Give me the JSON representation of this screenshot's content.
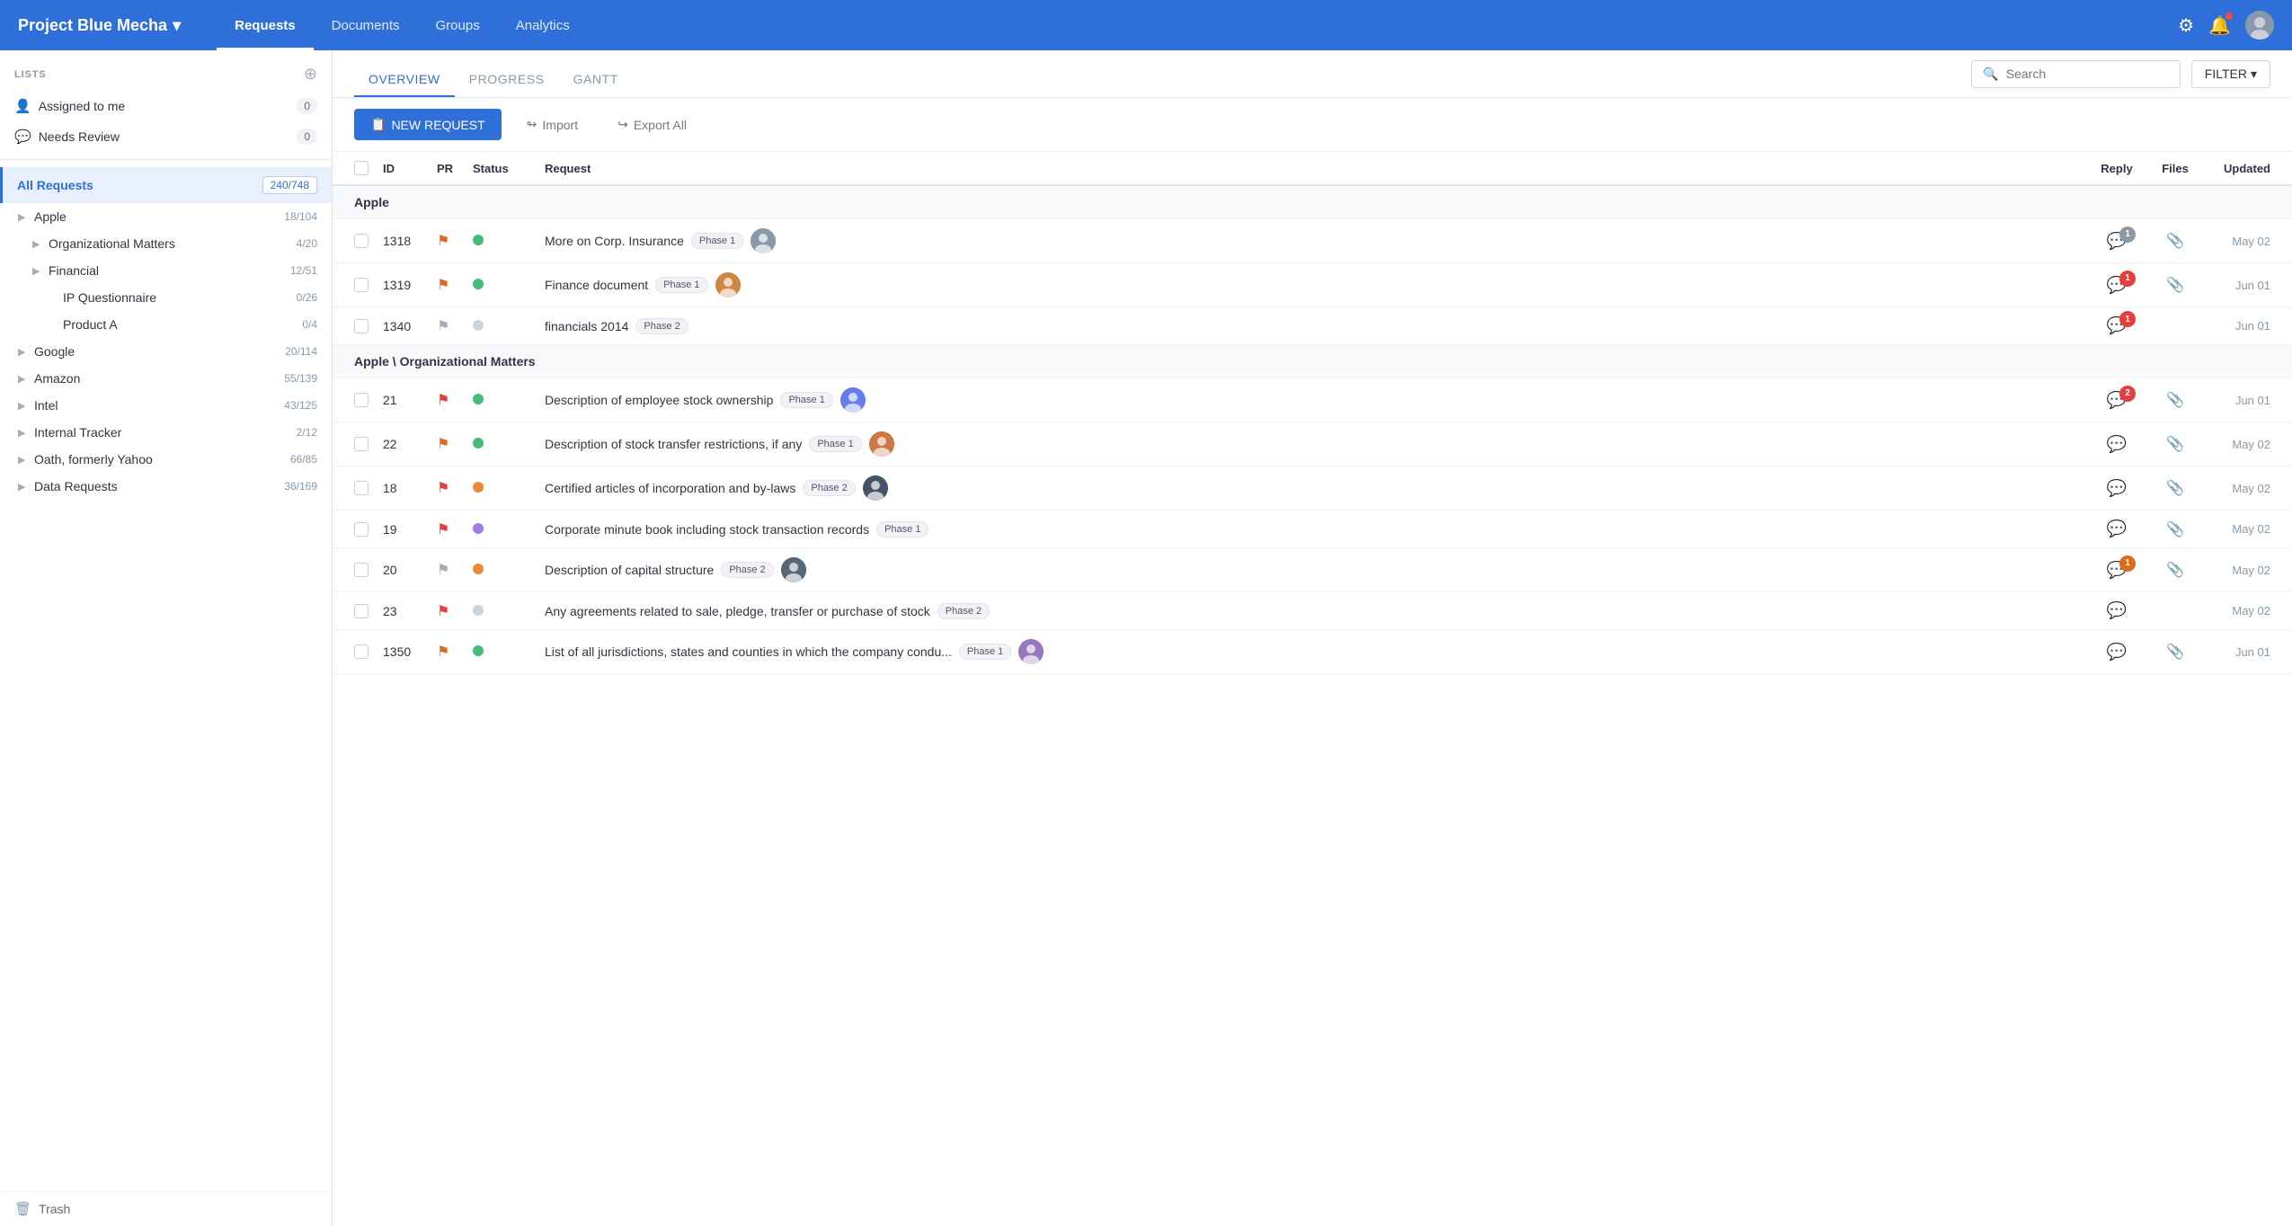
{
  "brand": {
    "title": "Project Blue Mecha",
    "chevron": "▾"
  },
  "top_nav": {
    "links": [
      {
        "label": "Requests",
        "active": true
      },
      {
        "label": "Documents",
        "active": false
      },
      {
        "label": "Groups",
        "active": false
      },
      {
        "label": "Analytics",
        "active": false
      }
    ]
  },
  "sidebar": {
    "lists_label": "LISTS",
    "items": [
      {
        "icon": "👤",
        "label": "Assigned to me",
        "count": "0"
      },
      {
        "icon": "💬",
        "label": "Needs Review",
        "count": "0"
      }
    ],
    "all_requests": {
      "label": "All Requests",
      "count": "240/748"
    },
    "tree": [
      {
        "level": 1,
        "label": "Apple",
        "count": "18/104",
        "expanded": true
      },
      {
        "level": 2,
        "label": "Organizational Matters",
        "count": "4/20",
        "expanded": false
      },
      {
        "level": 2,
        "label": "Financial",
        "count": "12/51",
        "expanded": false
      },
      {
        "level": 3,
        "label": "IP Questionnaire",
        "count": "0/26"
      },
      {
        "level": 3,
        "label": "Product A",
        "count": "0/4"
      },
      {
        "level": 1,
        "label": "Google",
        "count": "20/114",
        "expanded": false
      },
      {
        "level": 1,
        "label": "Amazon",
        "count": "55/139",
        "expanded": false
      },
      {
        "level": 1,
        "label": "Intel",
        "count": "43/125",
        "expanded": false
      },
      {
        "level": 1,
        "label": "Internal Tracker",
        "count": "2/12",
        "expanded": false
      },
      {
        "level": 1,
        "label": "Oath, formerly Yahoo",
        "count": "66/85",
        "expanded": false
      },
      {
        "level": 1,
        "label": "Data Requests",
        "count": "36/169",
        "expanded": false
      }
    ],
    "trash_label": "Trash"
  },
  "sub_nav": {
    "tabs": [
      {
        "label": "OVERVIEW",
        "active": true
      },
      {
        "label": "PROGRESS",
        "active": false
      },
      {
        "label": "GANTT",
        "active": false
      }
    ],
    "search_placeholder": "Search",
    "filter_label": "FILTER"
  },
  "toolbar": {
    "new_request_label": "NEW REQUEST",
    "import_label": "Import",
    "export_label": "Export All"
  },
  "table": {
    "headers": {
      "id": "ID",
      "pr": "PR",
      "status": "Status",
      "request": "Request",
      "reply": "Reply",
      "files": "Files",
      "updated": "Updated"
    },
    "groups": [
      {
        "name": "Apple",
        "rows": [
          {
            "id": "1318",
            "pr": "flag-orange",
            "status": "green",
            "request": "More on Corp. Insurance",
            "phase": "Phase 1",
            "has_avatar": true,
            "avatar_color": "#8899aa",
            "reply_count": "1",
            "reply_color": "gray",
            "has_clip": true,
            "updated": "May 02"
          },
          {
            "id": "1319",
            "pr": "flag-orange",
            "status": "green",
            "request": "Finance document",
            "phase": "Phase 1",
            "has_avatar": true,
            "avatar_color": "#cc8844",
            "reply_count": "1",
            "reply_color": "red",
            "has_clip": true,
            "updated": "Jun 01"
          },
          {
            "id": "1340",
            "pr": "flag-gray",
            "status": "gray",
            "request": "financials 2014",
            "phase": "Phase 2",
            "has_avatar": false,
            "reply_count": "1",
            "reply_color": "red",
            "has_clip": false,
            "updated": "Jun 01"
          }
        ]
      },
      {
        "name": "Apple \\Organizational Matters",
        "rows": [
          {
            "id": "21",
            "pr": "flag-red",
            "status": "green",
            "request": "Description of employee stock ownership",
            "phase": "Phase 1",
            "has_avatar": true,
            "avatar_color": "#667eea",
            "reply_count": "2",
            "reply_color": "red",
            "has_clip": true,
            "updated": "Jun 01"
          },
          {
            "id": "22",
            "pr": "flag-orange",
            "status": "green",
            "request": "Description of stock transfer restrictions, if any",
            "phase": "Phase 1",
            "has_avatar": true,
            "avatar_color": "#cc7744",
            "reply_count": "0",
            "reply_color": "none",
            "has_clip": true,
            "updated": "May 02"
          },
          {
            "id": "18",
            "pr": "flag-red",
            "status": "orange",
            "request": "Certified articles of incorporation and by-laws",
            "phase": "Phase 2",
            "has_avatar": true,
            "avatar_color": "#445566",
            "reply_count": "0",
            "reply_color": "none",
            "has_clip": true,
            "updated": "May 02"
          },
          {
            "id": "19",
            "pr": "flag-red",
            "status": "purple",
            "request": "Corporate minute book including stock transaction records",
            "phase": "Phase 1",
            "has_avatar": false,
            "reply_count": "0",
            "reply_color": "none",
            "has_clip": true,
            "updated": "May 02"
          },
          {
            "id": "20",
            "pr": "flag-gray",
            "status": "orange",
            "request": "Description of capital structure",
            "phase": "Phase 2",
            "has_avatar": true,
            "avatar_color": "#556677",
            "reply_count": "1",
            "reply_color": "orange",
            "has_clip": true,
            "updated": "May 02"
          },
          {
            "id": "23",
            "pr": "flag-red",
            "status": "gray",
            "request": "Any agreements related to sale, pledge, transfer or purchase of stock",
            "phase": "Phase 2",
            "has_avatar": false,
            "reply_count": "0",
            "reply_color": "none",
            "has_clip": false,
            "updated": "May 02"
          },
          {
            "id": "1350",
            "pr": "flag-orange",
            "status": "green",
            "request": "List of all jurisdictions, states and counties in which the company condu...",
            "phase": "Phase 1",
            "has_avatar": true,
            "avatar_color": "#9977bb",
            "reply_count": "0",
            "reply_color": "none",
            "has_clip": true,
            "updated": "Jun 01"
          }
        ]
      }
    ]
  }
}
